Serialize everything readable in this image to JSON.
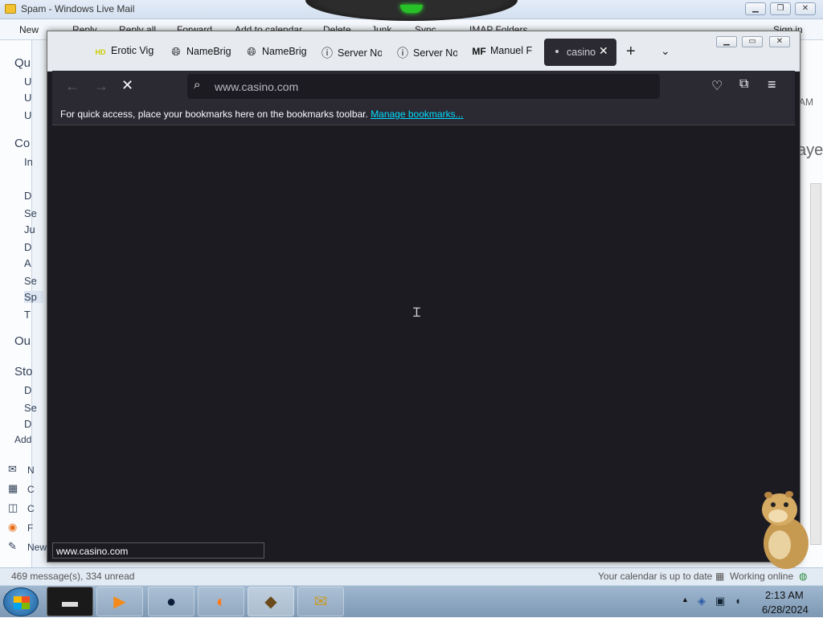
{
  "wlm": {
    "title": "Spam - Windows Live Mail",
    "ribbon": [
      "New",
      "Reply",
      "Reply all",
      "Forward",
      "Add to calendar",
      "Delete",
      "Junk",
      "Sync",
      "IMAP Folders",
      "Sign in"
    ],
    "left_labels": [
      "Qu",
      "U",
      "U",
      "U",
      "Co",
      "In",
      "D",
      "Se",
      "Ju",
      "D",
      "A",
      "Se",
      "Sp",
      "T",
      "Ou",
      "Sto",
      "D",
      "Se",
      "D",
      "Add",
      "N",
      "C",
      "C",
      "F",
      "New"
    ],
    "right_labels": [
      "AM",
      "aye"
    ],
    "status_left": "469 message(s), 334 unread",
    "status_calendar": "Your calendar is up to date",
    "status_online": "Working online"
  },
  "firefox": {
    "tabs": [
      {
        "label": "Erotic Vig",
        "icon": "hd-icon"
      },
      {
        "label": "NameBrig",
        "icon": "globe-icon"
      },
      {
        "label": "NameBrig",
        "icon": "globe-icon"
      },
      {
        "label": "Server No",
        "icon": "info-icon"
      },
      {
        "label": "Server No",
        "icon": "info-icon"
      },
      {
        "label": "Manuel F",
        "icon": "mf-icon"
      }
    ],
    "active_tab": {
      "label": "casino",
      "close": "✕"
    },
    "new_tab": "+",
    "tab_list": "⌄",
    "url": "www.casino.com",
    "bookmarks_msg": "For quick access, place your bookmarks here on the bookmarks toolbar. ",
    "bookmarks_link": "Manage bookmarks...",
    "status_link": "www.casino.com"
  },
  "taskbar": {
    "time": "2:13 AM",
    "date": "6/28/2024"
  }
}
